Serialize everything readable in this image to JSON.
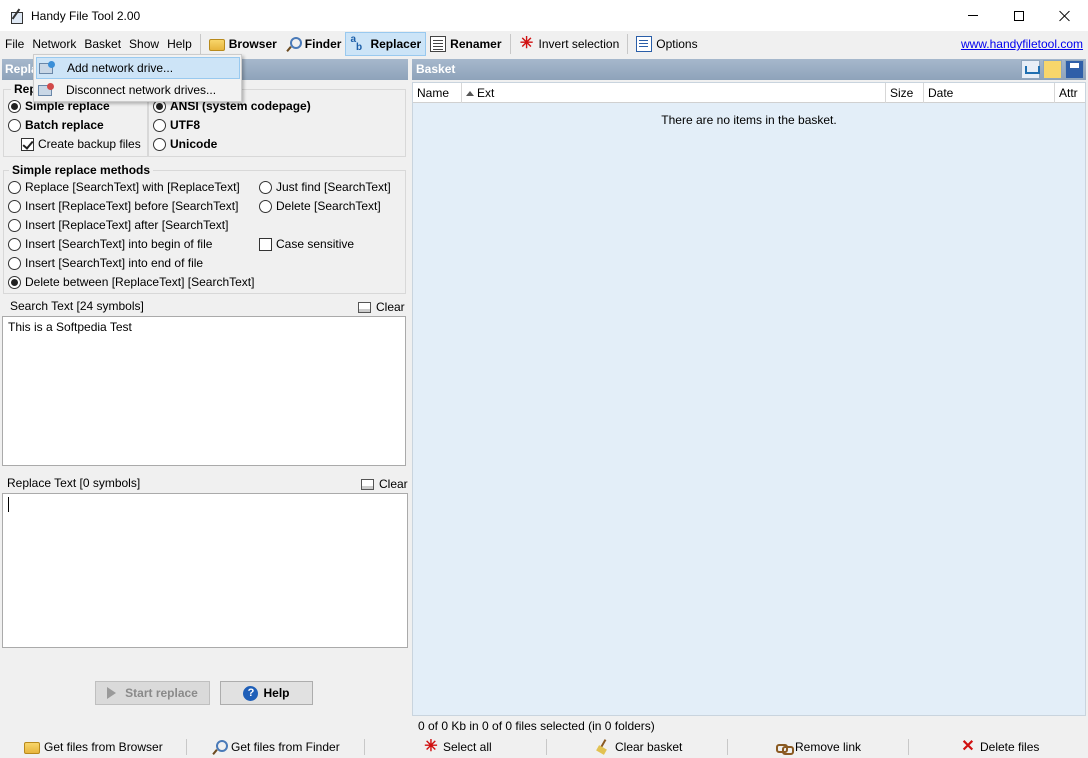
{
  "window": {
    "title": "Handy File Tool 2.00"
  },
  "menu": {
    "file": "File",
    "network": "Network",
    "basket": "Basket",
    "show": "Show",
    "help": "Help"
  },
  "toolbar": {
    "browser": "Browser",
    "finder": "Finder",
    "replacer": "Replacer",
    "renamer": "Renamer",
    "invert_selection": "Invert selection",
    "options": "Options",
    "website": "www.handyfiletool.com"
  },
  "network_menu": {
    "add": "Add network drive...",
    "disconnect": "Disconnect network drives..."
  },
  "replacer": {
    "header": "Repla",
    "group_label": "Rep",
    "simple_replace": "Simple replace",
    "batch_replace": "Batch replace",
    "create_backup": "Create backup files",
    "encoding_ansi": "ANSI (system codepage)",
    "encoding_utf8": "UTF8",
    "encoding_unicode": "Unicode",
    "methods_title": "Simple replace methods",
    "methods_left": [
      "Replace [SearchText] with [ReplaceText]",
      "Insert [ReplaceText] before [SearchText]",
      "Insert [ReplaceText] after [SearchText]",
      "Insert [SearchText] into begin of file",
      "Insert [SearchText] into end of file",
      "Delete between [ReplaceText] [SearchText]"
    ],
    "methods_right": [
      "Just find [SearchText]",
      "Delete [SearchText]"
    ],
    "case_sensitive": "Case sensitive",
    "search_label": "Search Text  [24 symbols]",
    "search_value": "This is a Softpedia Test",
    "replace_label": "Replace Text  [0 symbols]",
    "clear": "Clear",
    "start_replace": "Start replace",
    "help": "Help"
  },
  "basket": {
    "title": "Basket",
    "columns": [
      "Name",
      "Ext",
      "Size",
      "Date",
      "Attr"
    ],
    "empty_message": "There are no items in the basket.",
    "status": "0 of 0 Kb in 0 of 0 files selected (in 0 folders)"
  },
  "bottom": {
    "get_browser": "Get files from Browser",
    "get_finder": "Get files from Finder",
    "select_all": "Select all",
    "clear_basket": "Clear basket",
    "remove_link": "Remove link",
    "delete_files": "Delete files"
  }
}
